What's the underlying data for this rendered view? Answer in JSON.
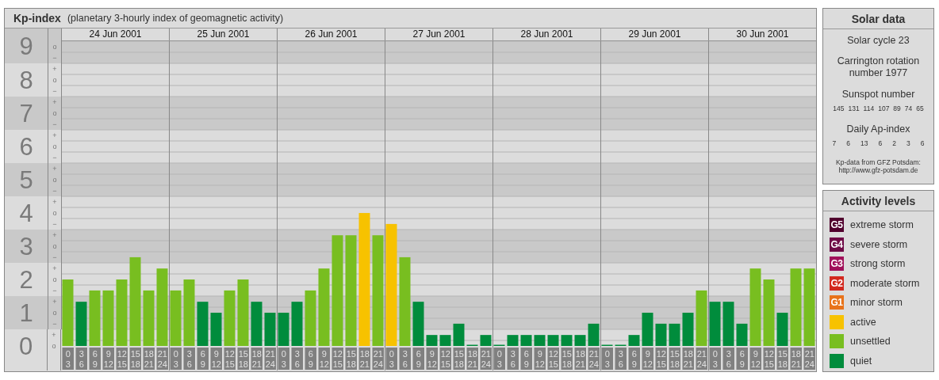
{
  "kp_panel": {
    "title": "Kp-index",
    "subtitle": "(planetary 3-hourly index of geomagnetic activity)",
    "minor_ticks": [
      "o",
      "−",
      "+",
      "o",
      "−",
      "+",
      "o",
      "−",
      "+",
      "o",
      "−",
      "+",
      "o",
      "−",
      "+",
      "o",
      "−",
      "+",
      "o",
      "−",
      "+",
      "o",
      "−",
      "+",
      "o",
      "−",
      "+",
      "o"
    ],
    "days": [
      {
        "date": "24 Jun 2001",
        "hours": [
          [
            "0",
            "3"
          ],
          [
            "3",
            "6"
          ],
          [
            "6",
            "9"
          ],
          [
            "9",
            "12"
          ],
          [
            "12",
            "15"
          ],
          [
            "15",
            "18"
          ],
          [
            "18",
            "21"
          ],
          [
            "21",
            "24"
          ]
        ]
      },
      {
        "date": "25 Jun 2001",
        "hours": [
          [
            "0",
            "3"
          ],
          [
            "3",
            "6"
          ],
          [
            "6",
            "9"
          ],
          [
            "9",
            "12"
          ],
          [
            "12",
            "15"
          ],
          [
            "15",
            "18"
          ],
          [
            "18",
            "21"
          ],
          [
            "21",
            "24"
          ]
        ]
      },
      {
        "date": "26 Jun 2001",
        "hours": [
          [
            "0",
            "3"
          ],
          [
            "3",
            "6"
          ],
          [
            "6",
            "9"
          ],
          [
            "9",
            "12"
          ],
          [
            "12",
            "15"
          ],
          [
            "15",
            "18"
          ],
          [
            "18",
            "21"
          ],
          [
            "21",
            "24"
          ]
        ]
      },
      {
        "date": "27 Jun 2001",
        "hours": [
          [
            "0",
            "3"
          ],
          [
            "3",
            "6"
          ],
          [
            "6",
            "9"
          ],
          [
            "9",
            "12"
          ],
          [
            "12",
            "15"
          ],
          [
            "15",
            "18"
          ],
          [
            "18",
            "21"
          ],
          [
            "21",
            "24"
          ]
        ]
      },
      {
        "date": "28 Jun 2001",
        "hours": [
          [
            "0",
            "3"
          ],
          [
            "3",
            "6"
          ],
          [
            "6",
            "9"
          ],
          [
            "9",
            "12"
          ],
          [
            "12",
            "15"
          ],
          [
            "15",
            "18"
          ],
          [
            "18",
            "21"
          ],
          [
            "21",
            "24"
          ]
        ]
      },
      {
        "date": "29 Jun 2001",
        "hours": [
          [
            "0",
            "3"
          ],
          [
            "3",
            "6"
          ],
          [
            "6",
            "9"
          ],
          [
            "9",
            "12"
          ],
          [
            "12",
            "15"
          ],
          [
            "15",
            "18"
          ],
          [
            "18",
            "21"
          ],
          [
            "21",
            "24"
          ]
        ]
      },
      {
        "date": "30 Jun 2001",
        "hours": [
          [
            "0",
            "3"
          ],
          [
            "3",
            "6"
          ],
          [
            "6",
            "9"
          ],
          [
            "9",
            "12"
          ],
          [
            "12",
            "15"
          ],
          [
            "15",
            "18"
          ],
          [
            "18",
            "21"
          ],
          [
            "21",
            "24"
          ]
        ]
      }
    ],
    "chart_data": {
      "type": "bar",
      "stacked": true,
      "grid": true,
      "ylim": [
        0,
        9.17
      ],
      "yticks": [
        9,
        8,
        7,
        6,
        5,
        4,
        3,
        2,
        1,
        0
      ],
      "bands": [
        {
          "axis": "y",
          "from": 8.5,
          "to": 9.17
        },
        {
          "axis": "y",
          "from": 6.5,
          "to": 7.5
        },
        {
          "axis": "y",
          "from": 4.5,
          "to": 5.5
        },
        {
          "axis": "y",
          "from": 2.5,
          "to": 3.5
        },
        {
          "axis": "y",
          "from": 0.5,
          "to": 1.5
        }
      ],
      "series": [
        {
          "name": "quiet",
          "color": "#008c3c",
          "values": [
            null,
            1.33,
            null,
            null,
            null,
            null,
            null,
            null,
            null,
            null,
            1.33,
            1,
            null,
            null,
            1.33,
            1,
            1,
            1.33,
            null,
            null,
            null,
            null,
            null,
            null,
            null,
            null,
            1.33,
            0.33,
            0.33,
            0.67,
            0,
            0.33,
            0,
            0.33,
            0.33,
            0.33,
            0.33,
            0.33,
            0.33,
            0.67,
            0,
            0,
            0.33,
            1,
            0.67,
            0.67,
            1,
            null,
            1.33,
            1.33,
            0.67,
            null,
            null,
            1,
            null,
            null
          ]
        },
        {
          "name": "unsettled",
          "color": "#78be20",
          "values": [
            2,
            null,
            1.67,
            1.67,
            2,
            2.67,
            1.67,
            2.33,
            1.67,
            2,
            null,
            null,
            1.67,
            2,
            null,
            null,
            null,
            null,
            1.67,
            2.33,
            3.33,
            3.33,
            null,
            3.33,
            null,
            2.67,
            null,
            null,
            null,
            null,
            null,
            null,
            null,
            null,
            null,
            null,
            null,
            null,
            null,
            null,
            null,
            null,
            null,
            null,
            null,
            null,
            null,
            1.67,
            null,
            null,
            null,
            2.33,
            2,
            null,
            2.33,
            2.33
          ]
        },
        {
          "name": "active",
          "color": "#f7c200",
          "values": [
            null,
            null,
            null,
            null,
            null,
            null,
            null,
            null,
            null,
            null,
            null,
            null,
            null,
            null,
            null,
            null,
            null,
            null,
            null,
            null,
            null,
            null,
            4,
            null,
            3.67,
            null,
            null,
            null,
            null,
            null,
            null,
            null,
            null,
            null,
            null,
            null,
            null,
            null,
            null,
            null,
            null,
            null,
            null,
            null,
            null,
            null,
            null,
            null,
            null,
            null,
            null,
            null,
            null,
            null,
            null,
            null
          ]
        }
      ]
    }
  },
  "solar_data": {
    "title": "Solar data",
    "cycle": "Solar cycle 23",
    "carrington": "Carrington rotation number 1977",
    "sunspot_title": "Sunspot number",
    "sunspots": [
      "145",
      "131",
      "114",
      "107",
      "89",
      "74",
      "65"
    ],
    "ap_title": "Daily Ap-index",
    "ap": [
      "7",
      "6",
      "13",
      "6",
      "2",
      "3",
      "6"
    ],
    "source": "Kp-data from GFZ Potsdam:",
    "link": "http://www.gfz-potsdam.de"
  },
  "activity_levels": {
    "title": "Activity levels",
    "items": [
      {
        "badge": "G5",
        "label": "extreme storm",
        "color": "#50002d"
      },
      {
        "badge": "G4",
        "label": "severe storm",
        "color": "#6e0a46"
      },
      {
        "badge": "G3",
        "label": "strong storm",
        "color": "#a0105a"
      },
      {
        "badge": "G2",
        "label": "moderate storm",
        "color": "#d2281e"
      },
      {
        "badge": "G1",
        "label": "minor storm",
        "color": "#e8731a"
      }
    ]
  }
}
